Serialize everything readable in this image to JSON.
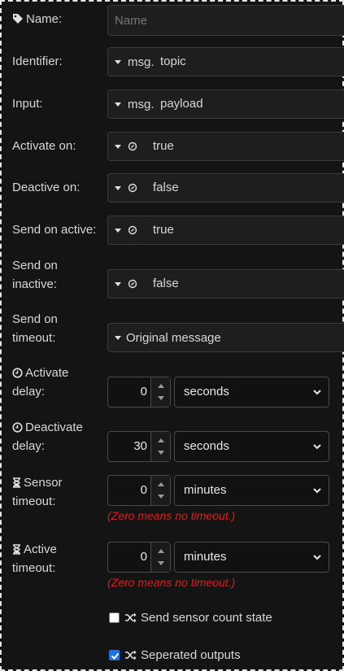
{
  "name": {
    "label": "Name:",
    "placeholder": "Name",
    "icon": "tag-icon"
  },
  "identifier": {
    "label": "Identifier:",
    "type": "msg.",
    "value": "topic"
  },
  "input": {
    "label": "Input:",
    "type": "msg.",
    "value": "payload"
  },
  "activate_on": {
    "label": "Activate on:",
    "value": "true"
  },
  "deactive_on": {
    "label": "Deactive on:",
    "value": "false"
  },
  "send_on_active": {
    "label": "Send on active:",
    "value": "true"
  },
  "send_on_inactive": {
    "label_1": "Send on",
    "label_2": "inactive:",
    "value": "false"
  },
  "send_on_timeout": {
    "label_1": "Send on",
    "label_2": "timeout:",
    "value": "Original message"
  },
  "activate_delay": {
    "label_1": "Activate",
    "label_2": "delay:",
    "value": "0",
    "unit": "seconds",
    "icon": "clock-icon"
  },
  "deactivate_delay": {
    "label_1": "Deactivate",
    "label_2": "delay:",
    "value": "30",
    "unit": "seconds",
    "icon": "clock-icon"
  },
  "sensor_timeout": {
    "label_1": "Sensor",
    "label_2": "timeout:",
    "value": "0",
    "unit": "minutes",
    "hint": "(Zero means no timeout.)",
    "icon": "hourglass-icon"
  },
  "active_timeout": {
    "label_1": "Active",
    "label_2": "timeout:",
    "value": "0",
    "unit": "minutes",
    "hint": "(Zero means no timeout.)",
    "icon": "hourglass-icon"
  },
  "send_sensor_count": {
    "label": "Send sensor count state",
    "checked": false,
    "icon": "random-icon"
  },
  "seperated_outputs": {
    "label": "Seperated outputs",
    "checked": true,
    "icon": "random-icon"
  },
  "colors": {
    "background": "#141414",
    "field": "#1e1e1e",
    "hint": "#d42020",
    "checkbox_on": "#1a73e8"
  }
}
